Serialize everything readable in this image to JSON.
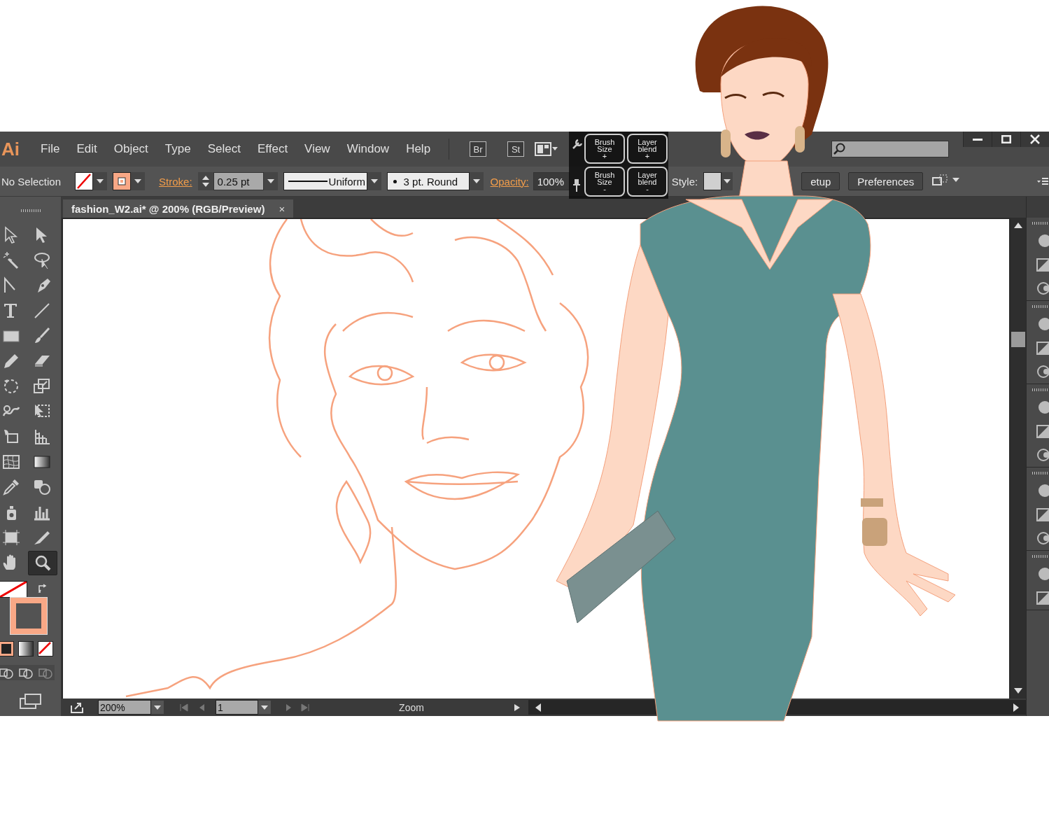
{
  "app": {
    "logo": "Ai"
  },
  "menu": [
    {
      "label": "File"
    },
    {
      "label": "Edit"
    },
    {
      "label": "Object"
    },
    {
      "label": "Type"
    },
    {
      "label": "Select"
    },
    {
      "label": "Effect"
    },
    {
      "label": "View"
    },
    {
      "label": "Window"
    },
    {
      "label": "Help"
    }
  ],
  "bridge_buttons": [
    "Br",
    "St"
  ],
  "touch_pad": [
    {
      "label": "Brush Size",
      "sign": "+"
    },
    {
      "label": "Layer blend",
      "sign": "+"
    },
    {
      "label": "Brush Size",
      "sign": "-"
    },
    {
      "label": "Layer blend",
      "sign": "-"
    }
  ],
  "control_bar": {
    "selection": "No Selection",
    "stroke_label": "Stroke:",
    "stroke_weight": "0.25 pt",
    "profile": "Uniform",
    "brush": "3 pt. Round",
    "opacity_label": "Opacity:",
    "opacity": "100%",
    "style_label": "Style:",
    "buttons": [
      "etup",
      "Preferences"
    ]
  },
  "tab": {
    "title": "fashion_W2.ai* @ 200% (RGB/Preview)",
    "close": "×"
  },
  "tools": [
    {
      "selected": false
    },
    {
      "selected": false
    },
    {
      "selected": false
    },
    {
      "selected": false
    },
    {
      "selected": false
    },
    {
      "selected": false
    },
    {
      "selected": false
    },
    {
      "selected": false
    },
    {
      "selected": false
    },
    {
      "selected": false
    },
    {
      "selected": false
    },
    {
      "selected": false
    },
    {
      "selected": false
    },
    {
      "selected": false
    },
    {
      "selected": false
    },
    {
      "selected": false
    },
    {
      "selected": false
    },
    {
      "selected": false
    },
    {
      "selected": false
    },
    {
      "selected": false
    },
    {
      "selected": false
    },
    {
      "selected": false
    },
    {
      "selected": false
    },
    {
      "selected": false
    },
    {
      "selected": false
    },
    {
      "selected": false
    },
    {
      "selected": false
    },
    {
      "selected": true
    }
  ],
  "status_bar": {
    "zoom": "200%",
    "artboard": "1",
    "tool": "Zoom"
  }
}
